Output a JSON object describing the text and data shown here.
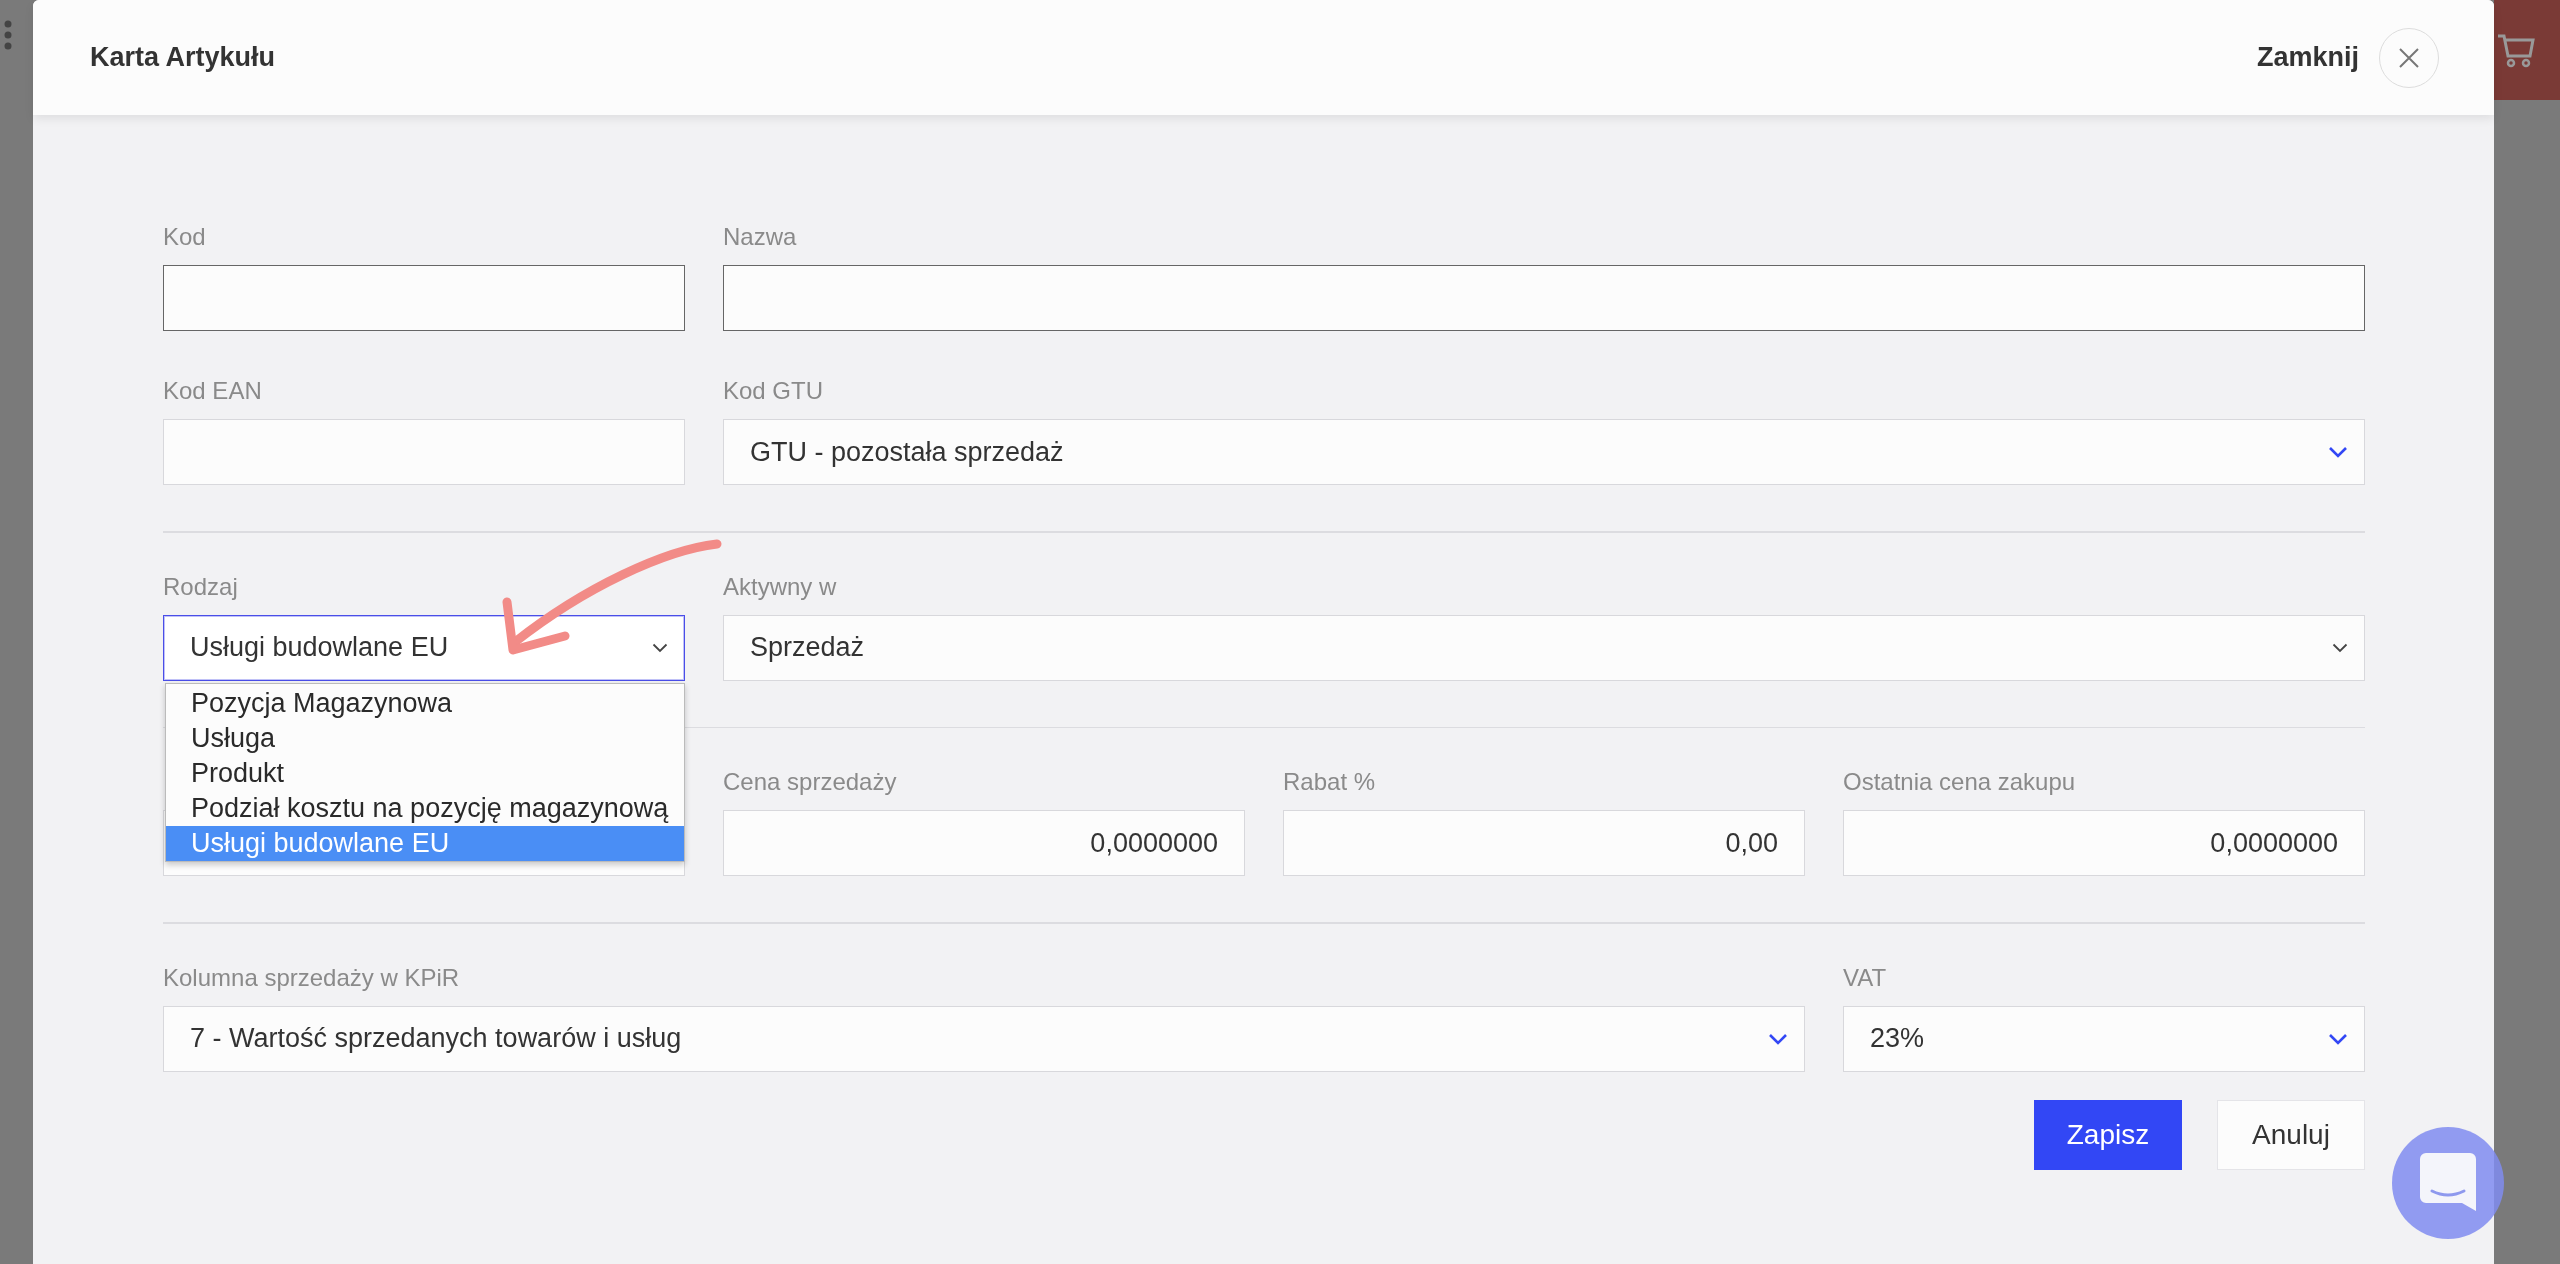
{
  "dialog": {
    "title": "Karta Artykułu",
    "close_label": "Zamknij"
  },
  "rows": [
    {
      "fields": [
        {
          "label": "Kod",
          "kind": "input"
        },
        {
          "label": "Nazwa",
          "kind": "input"
        }
      ]
    },
    {
      "fields": [
        {
          "label": "Kod EAN",
          "kind": "input"
        },
        {
          "label": "Kod GTU",
          "kind": "select",
          "value": "GTU - pozostała sprzedaż"
        }
      ]
    },
    {
      "fields": [
        {
          "label": "Rodzaj",
          "kind": "native-select",
          "value": "Usługi budowlane EU",
          "focused": true,
          "expanded": true,
          "options": [
            {
              "label": "Pozycja Magazynowa",
              "selected": false
            },
            {
              "label": "Usługa",
              "selected": false
            },
            {
              "label": "Produkt",
              "selected": false
            },
            {
              "label": "Podział kosztu na pozycję magazynową",
              "selected": false
            },
            {
              "label": "Usługi budowlane EU",
              "selected": true
            }
          ]
        },
        {
          "label": "Aktywny w",
          "kind": "native-select",
          "value": "Sprzedaż",
          "focused": false
        }
      ]
    },
    {
      "fields": [
        {
          "kind": "input"
        },
        {
          "label": "Cena sprzedaży",
          "kind": "number",
          "value": "0,0000000"
        },
        {
          "label": "Rabat %",
          "kind": "number",
          "value": "0,00"
        },
        {
          "label": "Ostatnia cena zakupu",
          "kind": "number",
          "value": "0,0000000"
        }
      ]
    },
    {
      "fields": [
        {
          "label": "Kolumna sprzedaży w KPiR",
          "kind": "select",
          "value": "7 - Wartość sprzedanych towarów i usług"
        },
        {
          "label": "VAT",
          "kind": "select",
          "value": "23%"
        }
      ]
    }
  ],
  "buttons": [
    {
      "label": "Zapisz",
      "kind": "primary"
    },
    {
      "label": "Anuluj",
      "kind": "secondary"
    }
  ]
}
